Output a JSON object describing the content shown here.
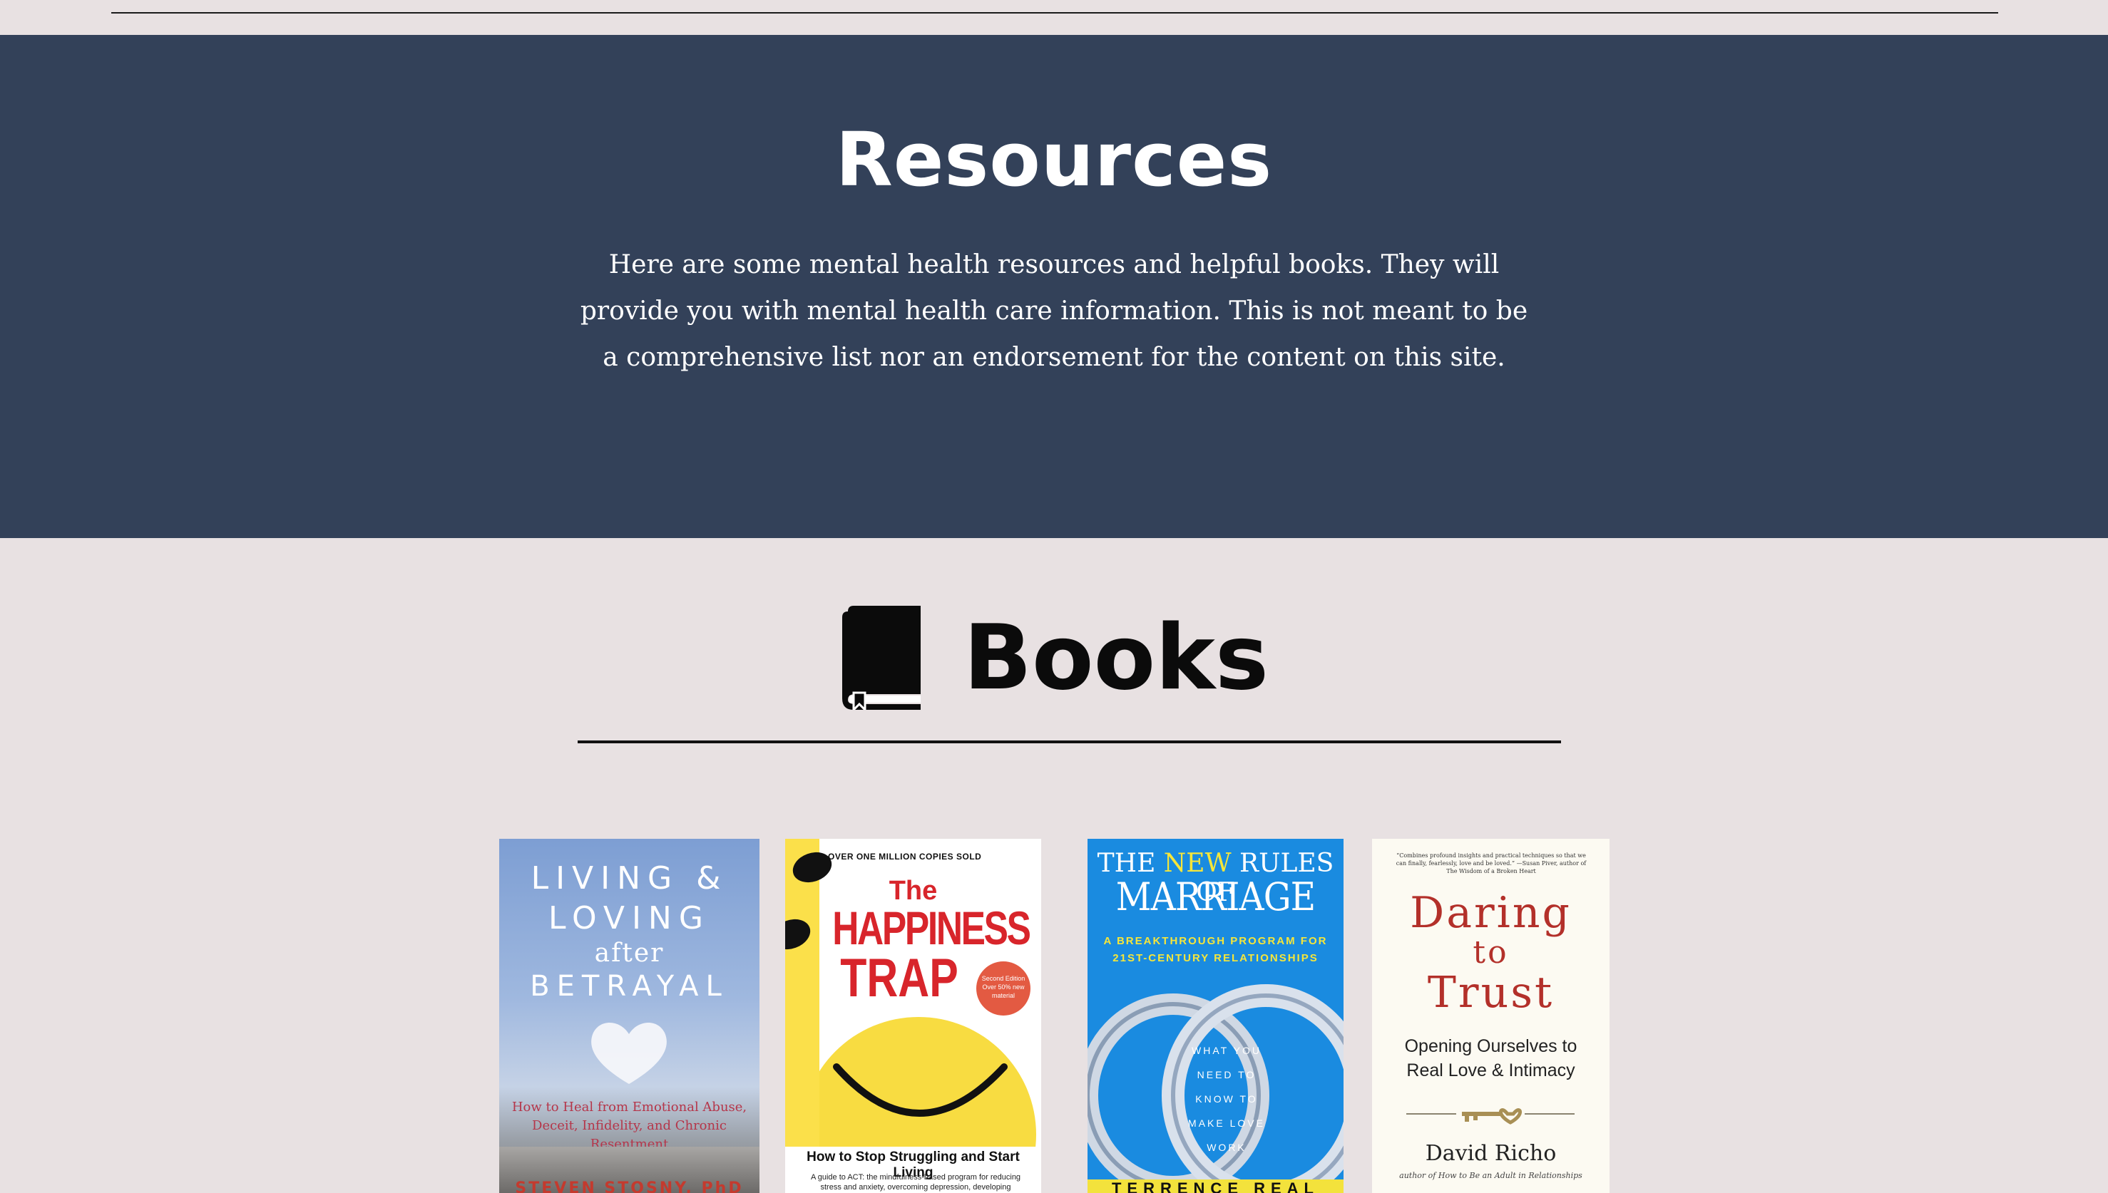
{
  "hero": {
    "title": "Resources",
    "description": "Here are some mental health resources and helpful books. They will provide you with mental health care information. This is not meant to be a comprehensive list nor an endorsement for the content on this site.",
    "background_color": "#334159"
  },
  "books_section": {
    "icon": "book-icon",
    "heading": "Books"
  },
  "books": [
    {
      "title_line1": "LIVING &",
      "title_line2": "LOVING",
      "title_line3": "after",
      "title_line4": "BETRAYAL",
      "subtitle": "How to Heal from Emotional Abuse, Deceit, Infidelity, and Chronic Resentment",
      "author": "STEVEN STOSNY, PhD"
    },
    {
      "banner": "OVER ONE MILLION COPIES SOLD",
      "title_line1": "The",
      "title_line2": "HAPPINESS",
      "title_line3": "TRAP",
      "badge": "Second Edition Over 50% new material",
      "subtitle": "How to Stop Struggling and Start Living",
      "blurb": "A guide to ACT: the mindfulness-based program for reducing stress and anxiety, overcoming depression, developing"
    },
    {
      "title_line1_a": "THE",
      "title_line1_b": "NEW",
      "title_line1_c": "RULES OF",
      "title_line2": "MARRIAGE",
      "tagline": "A BREAKTHROUGH PROGRAM FOR 21ST-CENTURY RELATIONSHIPS",
      "side_text": "WHAT YOU NEED TO KNOW TO MAKE LOVE WORK",
      "author": "TERRENCE REAL"
    },
    {
      "quote": "“Combines profound insights and practical techniques so that we can finally, fearlessly, love and be loved.” —Susan Piver, author of The Wisdom of a Broken Heart",
      "title_line1": "Daring",
      "title_line2": "to",
      "title_line3": "Trust",
      "subtitle_line1": "Opening Ourselves to",
      "subtitle_line2": "Real Love & Intimacy",
      "author": "David Richo",
      "author_note": "author of How to Be an Adult in Relationships"
    }
  ]
}
